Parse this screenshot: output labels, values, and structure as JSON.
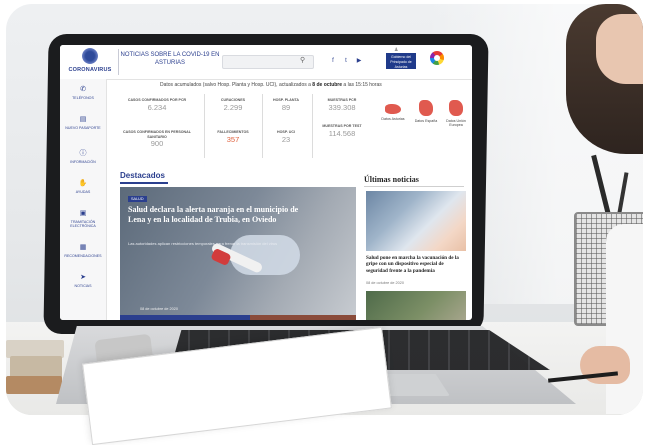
{
  "site": {
    "logo_text": "CORONAVIRUS",
    "header_title": "NOTICIAS SOBRE LA COVID-19 EN ASTURIAS",
    "gov_badge": "Gobierno del Principado de Asturias",
    "social_icons": [
      "facebook-icon",
      "twitter-icon",
      "youtube-icon"
    ]
  },
  "sidebar": {
    "items": [
      {
        "label": "TELÉFONOS",
        "icon": "phone-icon"
      },
      {
        "label": "NUEVO PASAPORTE",
        "icon": "calendar-icon"
      },
      {
        "label": "INFORMACIÓN",
        "icon": "info-icon"
      },
      {
        "label": "AYUDAS",
        "icon": "hand-icon"
      },
      {
        "label": "TRAMITACIÓN ELECTRÓNICA",
        "icon": "monitor-icon"
      },
      {
        "label": "RECOMENDACIONES",
        "icon": "clipboard-icon"
      },
      {
        "label": "NOTICIAS",
        "icon": "news-icon"
      }
    ]
  },
  "notice": {
    "prefix": "Datos acumulados (salvo Hosp. Planta y Hosp. UCI), actualizados a",
    "date": "8 de octubre",
    "suffix": "a las 15:15 horas"
  },
  "stats": {
    "pcr_label": "CASOS CONFIRMADOS POR PCR",
    "pcr_value": "6.234",
    "staff_label": "CASOS CONFIRMADOS EN PERSONAL SANITARIO",
    "staff_value": "900",
    "deaths_label": "FALLECIMIENTOS",
    "deaths_value": "357",
    "cured_label": "CURACIONES",
    "cured_value": "2.299",
    "plant_label": "HOSP. PLANTA",
    "plant_value": "89",
    "uci_label": "HOSP. UCI",
    "uci_value": "23",
    "samples_label": "MUESTRAS PCR",
    "samples_value": "339.308",
    "test_label": "MUESTRAS POR TEST",
    "test_value": "114.568",
    "maps": [
      "Datos Asturias",
      "Datos España",
      "Datos Unión Europea"
    ]
  },
  "featured": {
    "section_title": "Destacados",
    "tag": "SALUD",
    "title": "Salud declara la alerta naranja en el municipio de Lena y en la localidad de Trubia, en Oviedo",
    "desc": "Las autoridades aplican restricciones temporales para frenar la transmisión del virus",
    "date": "08 de octubre de 2020"
  },
  "news": {
    "section_title": "Últimas noticias",
    "item_title": "Salud pone en marcha la vacunación de la gripe con un dispositivo especial de seguridad frente a la pandemia",
    "item_date": "08 de octubre de 2020"
  }
}
